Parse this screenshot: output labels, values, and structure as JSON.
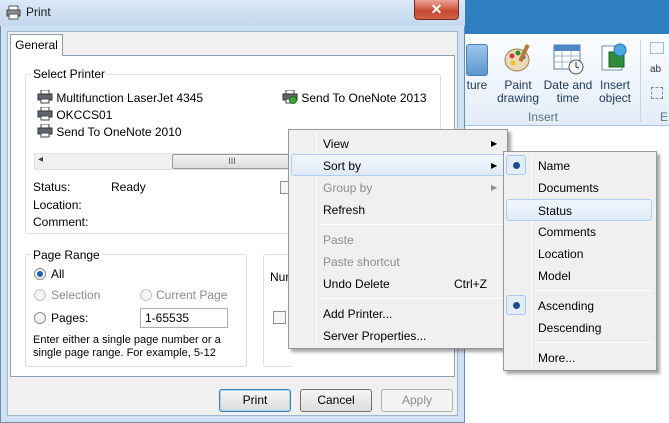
{
  "dialog": {
    "title": "Print",
    "close_glyph": "✕",
    "tab_label": "General",
    "select_printer": {
      "legend": "Select Printer",
      "printers_col1": [
        "Multifunction LaserJet 4345",
        "OKCCS01",
        "Send To OneNote 2010"
      ],
      "printers_col2": [
        "Send To OneNote 2013"
      ],
      "scroll_thumb_glyph": "III",
      "scroll_left_glyph": "◂",
      "status_label": "Status:",
      "status_value": "Ready",
      "location_label": "Location:",
      "comment_label": "Comment:"
    },
    "page_range": {
      "legend": "Page Range",
      "all_label": "All",
      "selection_label": "Selection",
      "current_page_label": "Current Page",
      "pages_label": "Pages:",
      "pages_value": "1-65535",
      "hint": "Enter either a single page number or a single page range.  For example, 5-12",
      "selected": "all"
    },
    "copies_partial_label": "Num",
    "buttons": {
      "print": "Print",
      "cancel": "Cancel",
      "apply": "Apply"
    }
  },
  "ribbon": {
    "items": [
      {
        "label_line1": "ture",
        "label_line2": ""
      },
      {
        "label_line1": "Paint",
        "label_line2": "drawing"
      },
      {
        "label_line1": "Date and",
        "label_line2": "time"
      },
      {
        "label_line1": "Insert",
        "label_line2": "object"
      }
    ],
    "group_label": "Insert",
    "group_label_2": "E",
    "small_label": "ab"
  },
  "context_menu": {
    "items": [
      {
        "label": "View",
        "submenu": true,
        "enabled": true
      },
      {
        "label": "Sort by",
        "submenu": true,
        "enabled": true,
        "highlighted": true
      },
      {
        "label": "Group by",
        "submenu": true,
        "enabled": false
      },
      {
        "label": "Refresh",
        "submenu": false,
        "enabled": true
      },
      {
        "label": "Paste",
        "submenu": false,
        "enabled": false
      },
      {
        "label": "Paste shortcut",
        "submenu": false,
        "enabled": false
      },
      {
        "label": "Undo Delete",
        "shortcut": "Ctrl+Z",
        "submenu": false,
        "enabled": true
      },
      {
        "label": "Add Printer...",
        "submenu": false,
        "enabled": true
      },
      {
        "label": "Server Properties...",
        "submenu": false,
        "enabled": true
      }
    ],
    "submenu_arrow": "▶"
  },
  "sort_menu": {
    "items": [
      {
        "label": "Name",
        "selected": true
      },
      {
        "label": "Documents",
        "selected": false
      },
      {
        "label": "Status",
        "selected": false,
        "highlighted": true
      },
      {
        "label": "Comments",
        "selected": false
      },
      {
        "label": "Location",
        "selected": false
      },
      {
        "label": "Model",
        "selected": false
      },
      {
        "label": "Ascending",
        "selected": true
      },
      {
        "label": "Descending",
        "selected": false
      },
      {
        "label": "More...",
        "selected": false
      }
    ]
  },
  "colors": {
    "accent": "#1f5fb3",
    "close_button": "#c84a32",
    "highlight_border": "#aecff7"
  }
}
